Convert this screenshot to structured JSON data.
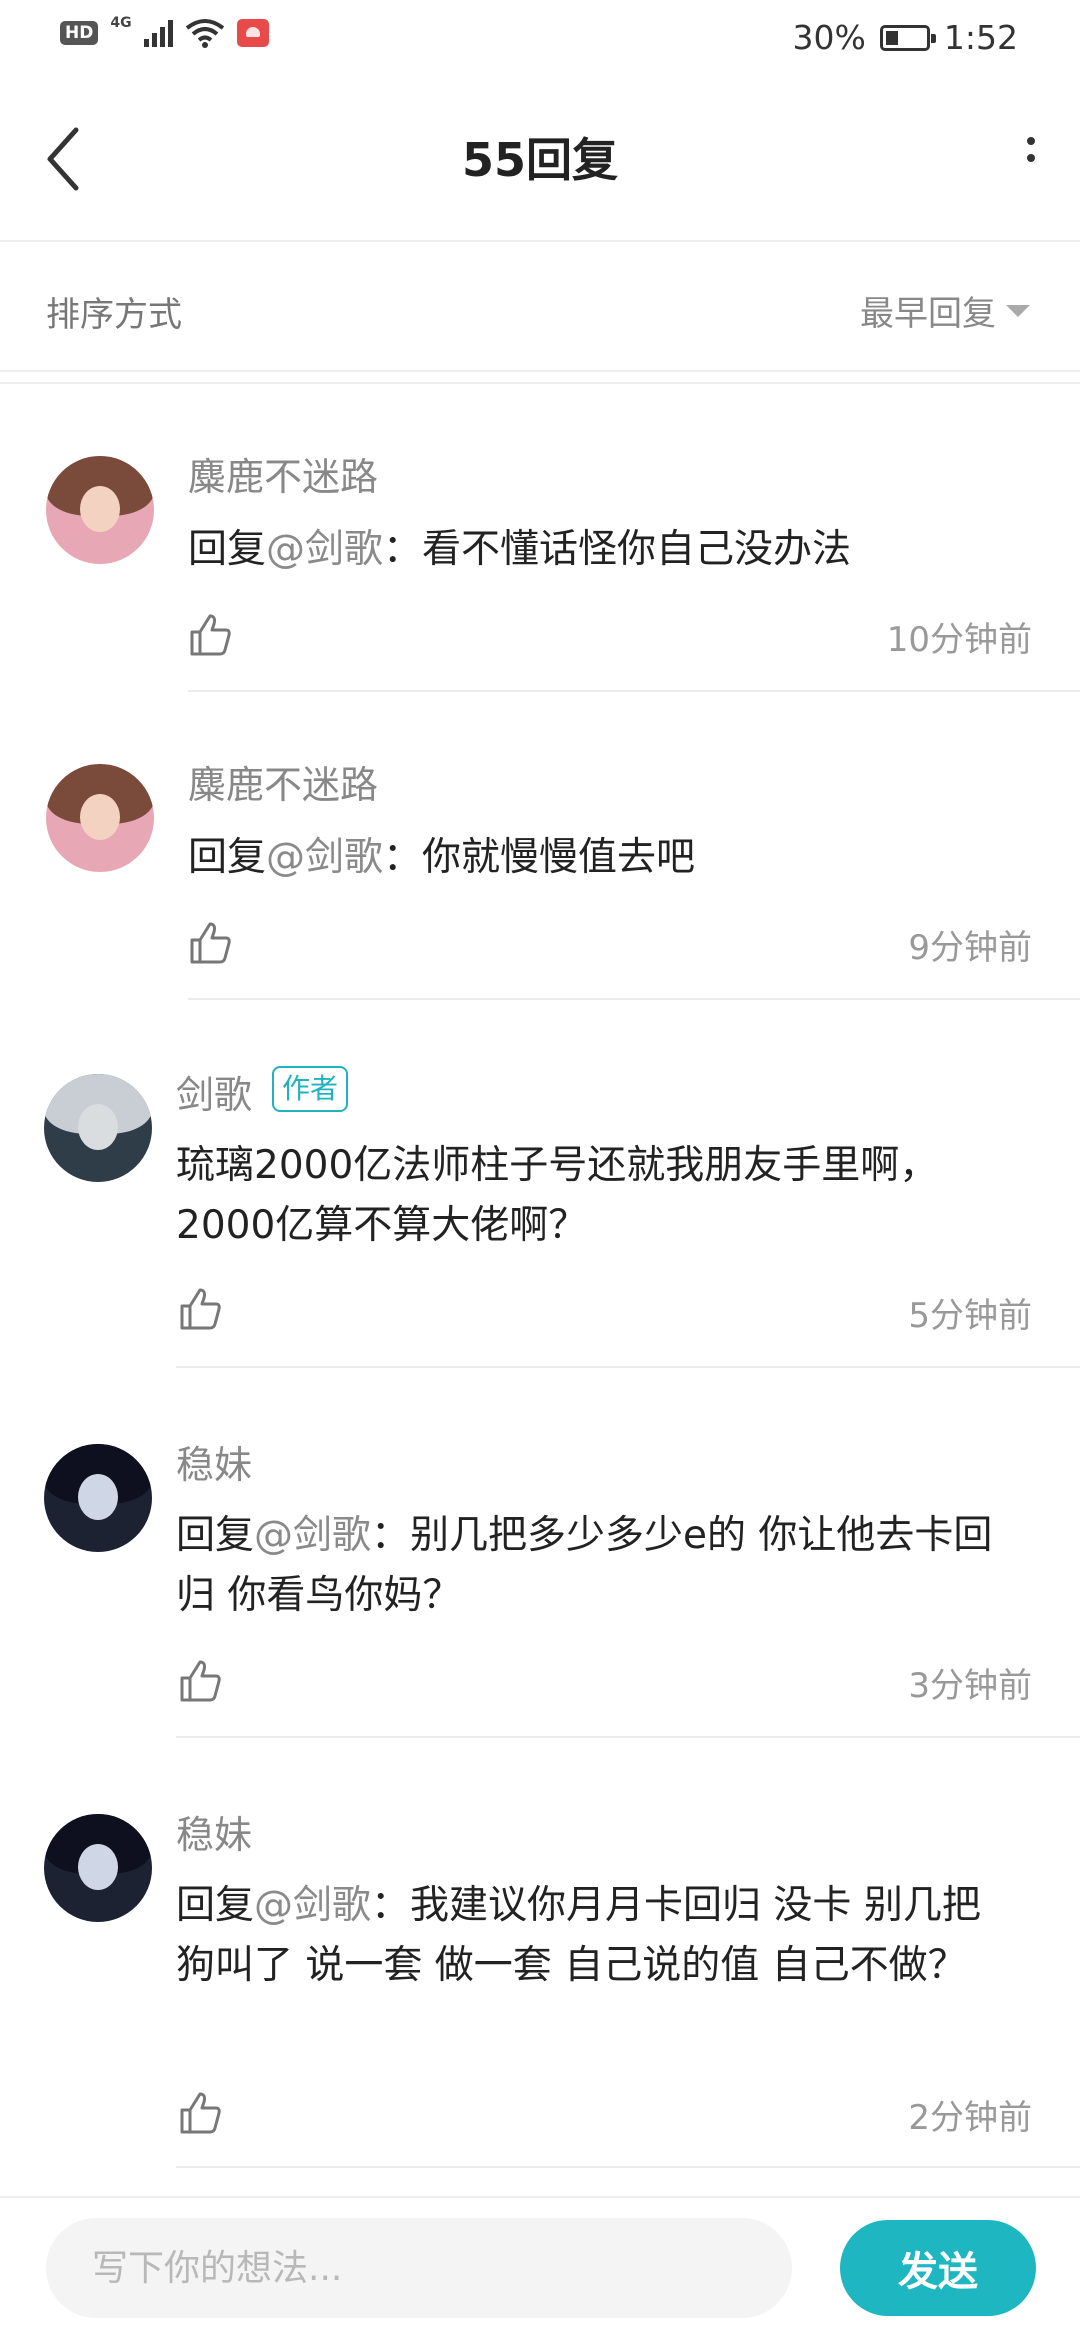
{
  "status_bar": {
    "hd": "HD",
    "network": "4G",
    "battery": "30%",
    "time": "1:52"
  },
  "header": {
    "back_icon": "back-arrow-icon",
    "title": "55回复",
    "more_icon": "more-vertical-icon"
  },
  "sort": {
    "label": "排序方式",
    "selected": "最早回复"
  },
  "comments": [
    {
      "user": "麋鹿不迷路",
      "prefix": "回复",
      "mention": "@剑歌",
      "text": "：看不懂话怪你自己没办法",
      "time": "10分钟前"
    },
    {
      "user": "麋鹿不迷路",
      "prefix": "回复",
      "mention": "@剑歌",
      "text": "：你就慢慢值去吧",
      "time": "9分钟前"
    },
    {
      "user": "剑歌",
      "tag": "作者",
      "text": "琉璃2000亿法师柱子号还就我朋友手里啊，2000亿算不算大佬啊？",
      "time": "5分钟前"
    },
    {
      "user": "稳妹",
      "prefix": "回复",
      "mention": "@剑歌",
      "text": "：别几把多少多少e的  你让他去卡回归 你看鸟你妈？",
      "time": "3分钟前"
    },
    {
      "user": "稳妹",
      "prefix": "回复",
      "mention": "@剑歌",
      "text": "：我建议你月月卡回归   没卡 别几把狗叫了  说一套 做一套 自己说的值   自己不做？",
      "time": "2分钟前"
    }
  ],
  "composer": {
    "placeholder": "写下你的想法...",
    "send_label": "发送"
  },
  "colors": {
    "accent": "#1db6c1",
    "author_tag": "#20b3bf",
    "muted_text": "#888888"
  }
}
